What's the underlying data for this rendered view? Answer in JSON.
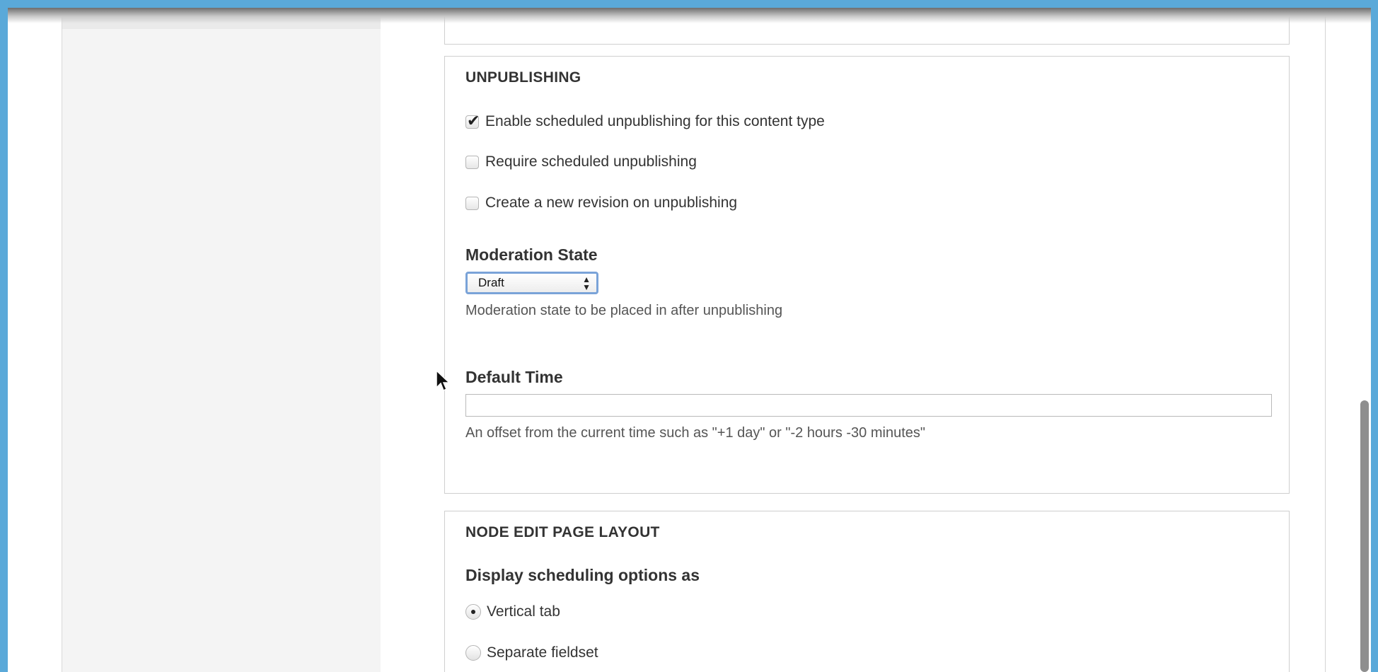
{
  "unpublishing": {
    "legend": "UNPUBLISHING",
    "enable_label": "Enable scheduled unpublishing for this content type",
    "enable_checked": true,
    "require_label": "Require scheduled unpublishing",
    "require_checked": false,
    "revision_label": "Create a new revision on unpublishing",
    "revision_checked": false,
    "moderation_title": "Moderation State",
    "moderation_value": "Draft",
    "moderation_desc": "Moderation state to be placed in after unpublishing",
    "default_time_title": "Default Time",
    "default_time_value": "",
    "default_time_desc": "An offset from the current time such as \"+1 day\" or \"-2 hours -30 minutes\""
  },
  "layout": {
    "legend": "NODE EDIT PAGE LAYOUT",
    "display_title": "Display scheduling options as",
    "options": [
      {
        "label": "Vertical tab",
        "checked": true
      },
      {
        "label": "Separate fieldset",
        "checked": false
      }
    ]
  },
  "icons": {
    "cursor": "mouse-pointer-icon",
    "select_arrows": "updown-arrows-icon"
  }
}
